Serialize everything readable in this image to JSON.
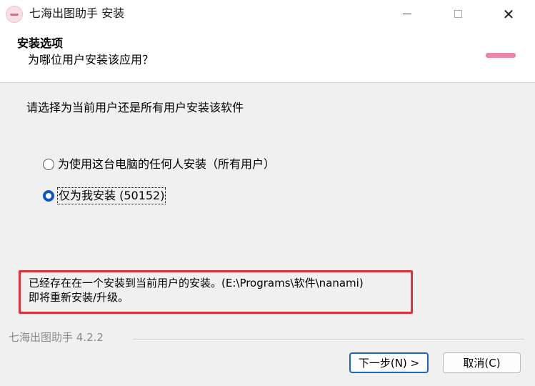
{
  "window": {
    "title": "七海出图助手 安装",
    "minimize_icon": "minimize-icon",
    "maximize_icon": "maximize-icon",
    "close_icon": "close-icon",
    "close_glyph": "✕"
  },
  "header": {
    "title": "安装选项",
    "subtitle": "为哪位用户安装该应用？"
  },
  "body": {
    "prompt": "请选择为当前用户还是所有用户安装该软件",
    "options": [
      {
        "label": "为使用这台电脑的任何人安装（所有用户）",
        "checked": false
      },
      {
        "label": "仅为我安装 (50152)",
        "checked": true
      }
    ],
    "notice_line1": "已经存在在一个安装到当前用户的安装。(E:\\Programs\\软件\\nanami)",
    "notice_line2": "即将重新安装/升级。"
  },
  "footer": {
    "brand": "七海出图助手 4.2.2",
    "next_label": "下一步(N) >",
    "cancel_label": "取消(C)"
  },
  "colors": {
    "accent": "#0a58c6",
    "notice_border": "#e0303a",
    "background": "#f0f0f0"
  }
}
